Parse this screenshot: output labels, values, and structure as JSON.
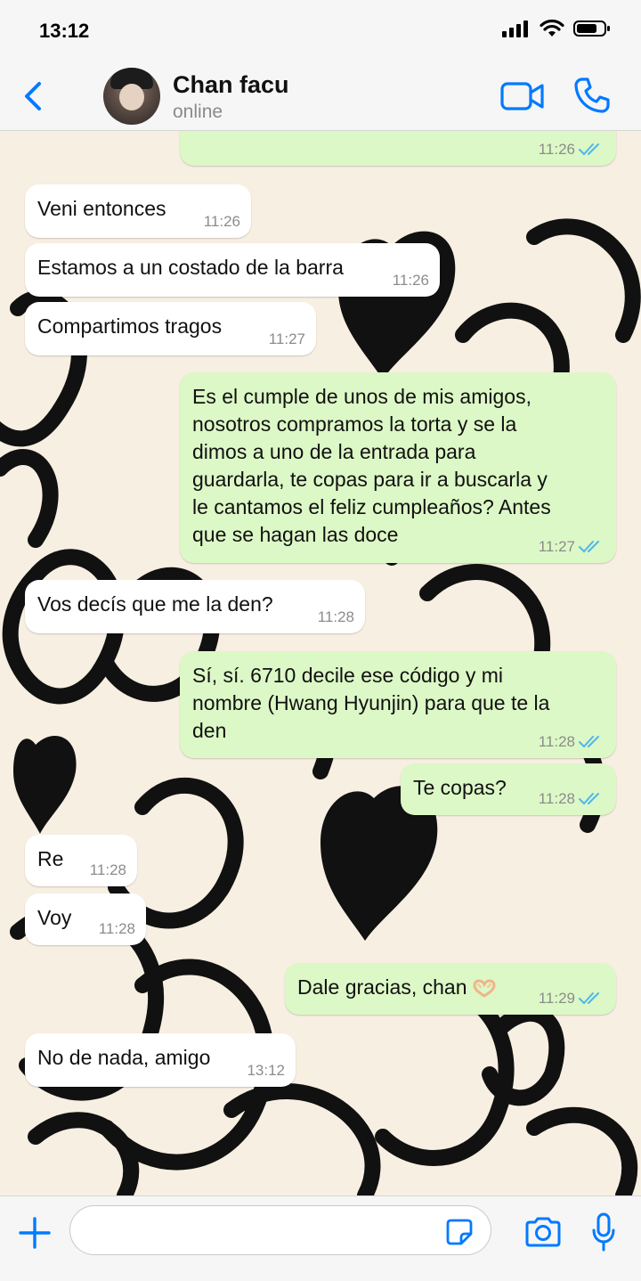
{
  "status_bar": {
    "time": "13:12"
  },
  "header": {
    "name": "Chan facu",
    "status": "online"
  },
  "messages": [
    {
      "dir": "out",
      "text": "",
      "time": "11:26",
      "read": true
    },
    {
      "dir": "in",
      "text": "Veni entonces",
      "time": "11:26"
    },
    {
      "dir": "in",
      "text": "Estamos a un costado de la barra",
      "time": "11:26"
    },
    {
      "dir": "in",
      "text": "Compartimos tragos",
      "time": "11:27"
    },
    {
      "dir": "out",
      "text": "Es el cumple de unos de mis amigos,\nnosotros compramos la torta y se la\ndimos a uno de la entrada para\nguardarla, te copas para ir a buscarla y\nle cantamos el feliz cumpleaños? Antes\nque se hagan las doce",
      "time": "11:27",
      "read": true
    },
    {
      "dir": "in",
      "text": "Vos decís que me la den?",
      "time": "11:28"
    },
    {
      "dir": "out",
      "text": "Sí, sí. 6710 decile ese código y mi\nnombre (Hwang Hyunjin) para que te la\nden",
      "time": "11:28",
      "read": true
    },
    {
      "dir": "out",
      "text": "Te copas?",
      "time": "11:28",
      "read": true
    },
    {
      "dir": "in",
      "text": "Re",
      "time": "11:28"
    },
    {
      "dir": "in",
      "text": "Voy",
      "time": "11:28"
    },
    {
      "dir": "out",
      "text": "Dale gracias, chan",
      "emoji": "heart-hands-emoji",
      "time": "11:29",
      "read": true
    },
    {
      "dir": "in",
      "text": "No de nada, amigo",
      "time": "13:12"
    }
  ],
  "composer": {
    "placeholder": ""
  },
  "colors": {
    "accent": "#007aff",
    "outgoing_bubble": "#dcf8c6",
    "incoming_bubble": "#ffffff",
    "read_ticks": "#4fb6ec",
    "wallpaper": "#f7efe1"
  }
}
